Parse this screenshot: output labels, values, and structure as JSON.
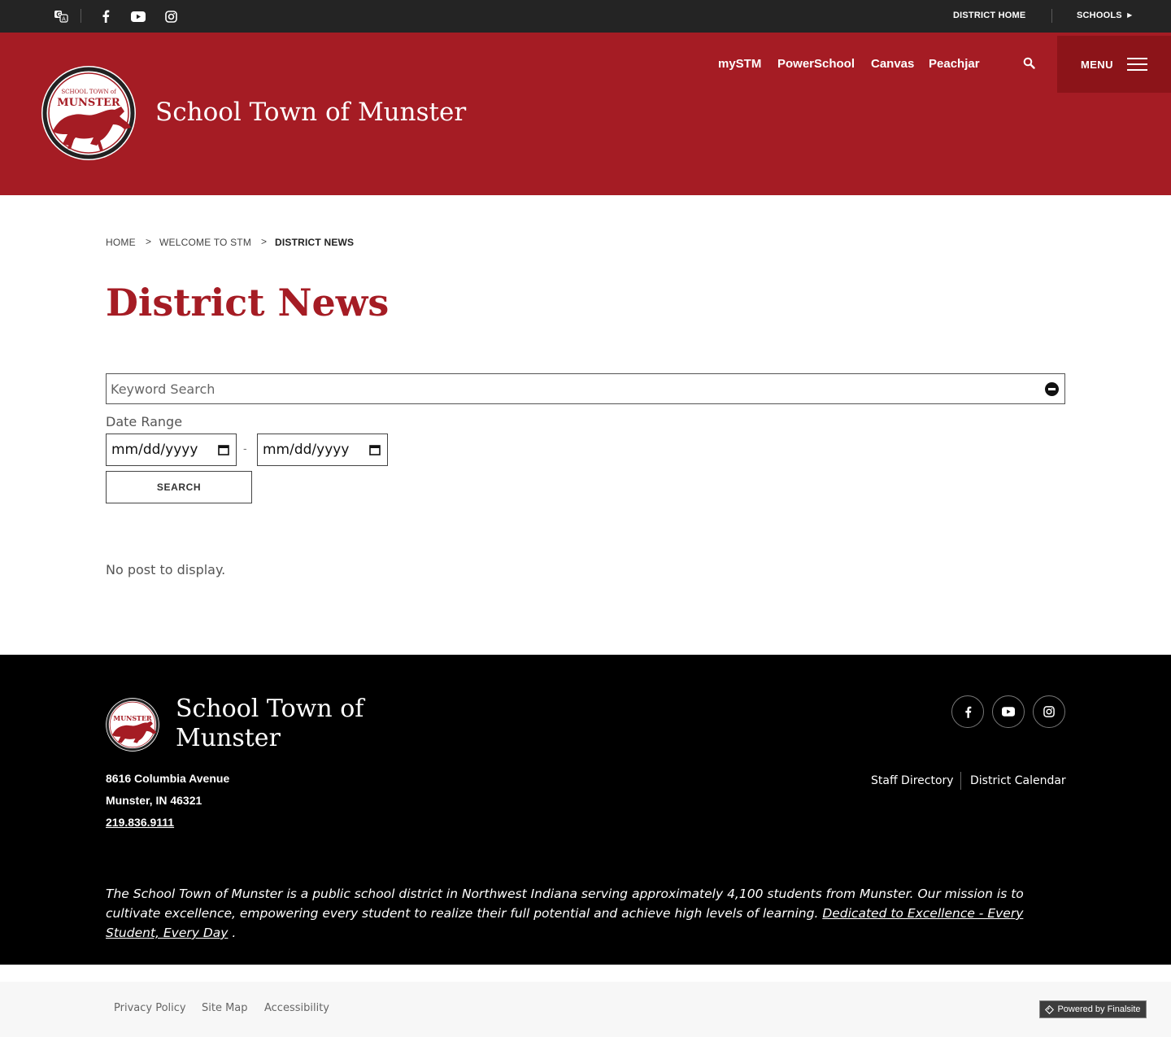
{
  "utility_bar": {
    "district_home": "DISTRICT HOME",
    "schools": "SCHOOLS"
  },
  "header": {
    "site_title": "School Town of Munster",
    "logo_text": "MUNSTER",
    "logo_small": "SCHOOL TOWN of",
    "quick_links": [
      "mySTM",
      "PowerSchool",
      "Canvas",
      "Peachjar"
    ],
    "menu_label": "MENU"
  },
  "breadcrumb": [
    "HOME",
    "WELCOME TO STM",
    "DISTRICT NEWS"
  ],
  "page_title": "District News",
  "search_form": {
    "keyword_placeholder": "Keyword Search",
    "date_range_label": "Date Range",
    "start_date": "mm/dd/yyyy",
    "end_date": "mm/dd/yyyy",
    "date_separator": "-",
    "submit_label": "SEARCH"
  },
  "results_message": "No post to display.",
  "footer": {
    "title_line1": "School Town of",
    "title_line2": "Munster",
    "address_line1": "8616 Columbia Avenue",
    "address_line2": "Munster, IN  46321",
    "phone": "219.836.9111",
    "links": [
      "Staff Directory",
      "District Calendar"
    ],
    "mission_text": "The School Town of Munster is a public school district in Northwest Indiana serving approximately 4,100 students from Munster. Our mission is to cultivate excellence, empowering every student to realize their full potential and achieve high levels of learning.",
    "mission_link": "Dedicated to Excellence - Every Student, Every Day",
    "mission_end": "."
  },
  "bottom_bar": {
    "links": [
      "Privacy Policy",
      "Site Map",
      "Accessibility"
    ],
    "powered_by": "Powered by Finalsite"
  },
  "colors": {
    "brand_red": "#a51c24",
    "menu_red": "#8c1419",
    "topbar": "#242424",
    "footer": "#000000"
  },
  "icons": [
    "translate-icon",
    "facebook-icon",
    "youtube-icon",
    "instagram-icon",
    "search-icon",
    "hamburger-icon",
    "calendar-icon",
    "clear-icon",
    "finalsite-icon"
  ]
}
